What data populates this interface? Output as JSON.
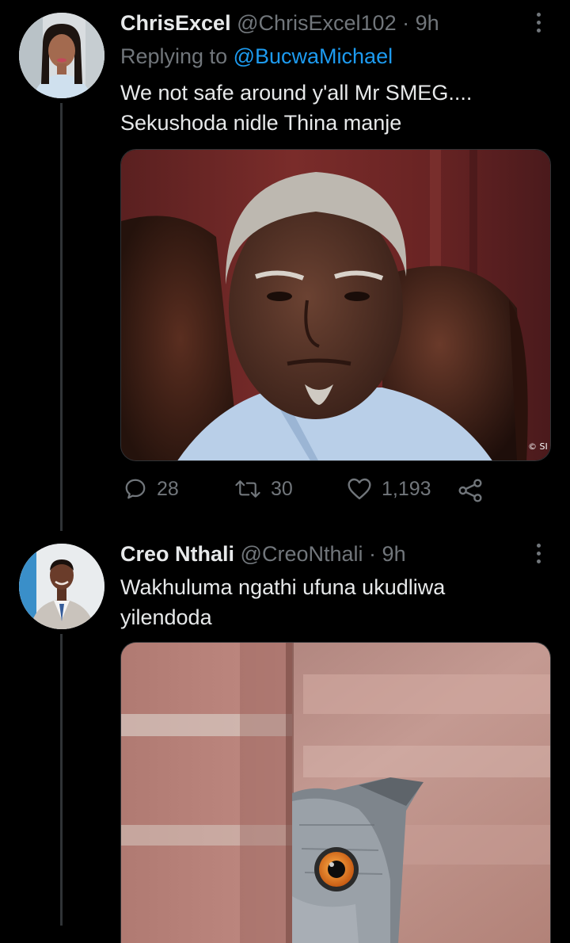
{
  "tweets": [
    {
      "name": "ChrisExcel",
      "handle": "@ChrisExcel102",
      "time": "9h",
      "replying_prefix": "Replying to ",
      "replying_to": "@BucwaMichael",
      "text_line1": "We not safe around y'all Mr SMEG....",
      "text_line2": "Sekushoda nidle Thina manje",
      "image_watermark": "© SI",
      "replies": "28",
      "retweets": "30",
      "likes": "1,193"
    },
    {
      "name": "Creo Nthali",
      "handle": "@CreoNthali",
      "time": "9h",
      "text_line1": "Wakhuluma ngathi ufuna ukudliwa",
      "text_line2": "yilendoda"
    }
  ],
  "separator": "·",
  "icons": {
    "reply": "reply-icon",
    "retweet": "retweet-icon",
    "like": "heart-icon",
    "share": "share-icon",
    "more": "more-icon"
  },
  "colors": {
    "background": "#000000",
    "text": "#e7e9ea",
    "muted": "#71767b",
    "link": "#1d9bf0"
  }
}
